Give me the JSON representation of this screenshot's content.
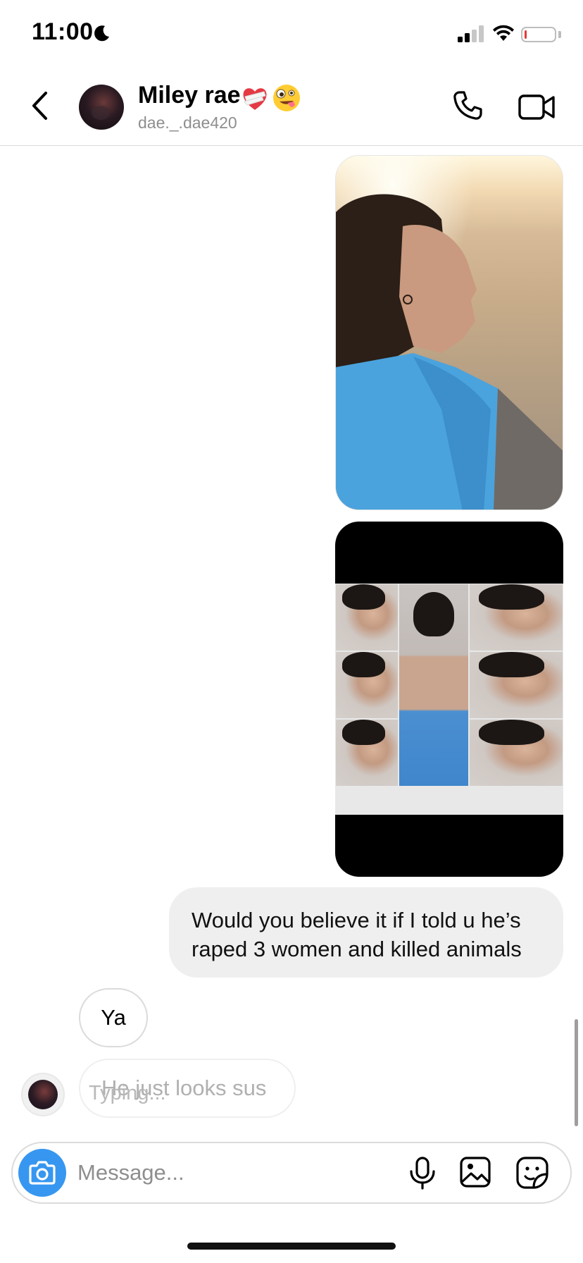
{
  "status_bar": {
    "time": "11:00",
    "moon_icon": "moon-icon",
    "signal_icon": "cellular-signal-icon",
    "wifi_icon": "wifi-icon",
    "battery_icon": "battery-low-icon",
    "battery_color": "#e53935"
  },
  "header": {
    "back_icon": "chevron-left-icon",
    "contact_name": "Miley rae",
    "name_emojis": [
      "❤️‍🩹",
      "🤪"
    ],
    "username": "dae._.dae420",
    "call_icon": "phone-icon",
    "video_icon": "video-camera-icon"
  },
  "messages": [
    {
      "type": "image",
      "from": "me",
      "description_icon": "photo-icon"
    },
    {
      "type": "image",
      "from": "me",
      "description_icon": "photo-collage-icon"
    },
    {
      "type": "text",
      "from": "me",
      "text": "Would you believe it if I told u he’s raped 3 women and killed animals"
    },
    {
      "type": "text",
      "from": "them",
      "text": "Ya"
    },
    {
      "type": "text",
      "from": "them",
      "text": "He just looks sus"
    }
  ],
  "typing_indicator": "Typing...",
  "composer": {
    "placeholder": "Message...",
    "camera_icon": "camera-icon",
    "camera_color": "#3797f0",
    "mic_icon": "microphone-icon",
    "gallery_icon": "gallery-icon",
    "sticker_icon": "sticker-icon"
  }
}
